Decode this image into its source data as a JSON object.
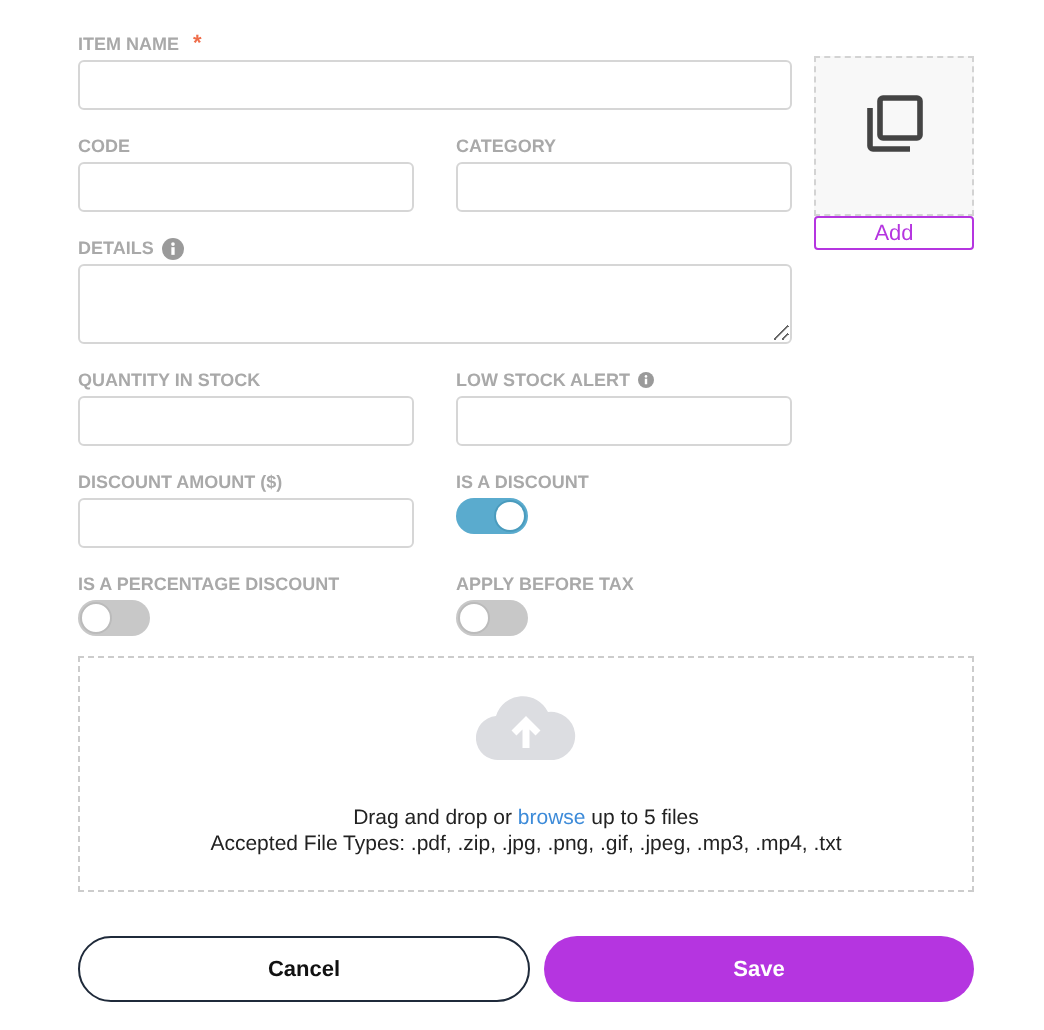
{
  "form": {
    "fields": [
      {
        "kind": "wide_text",
        "label": "ITEM NAME",
        "required": true
      },
      {
        "kind": "text",
        "label": "CODE"
      },
      {
        "kind": "text",
        "label": "CATEGORY"
      },
      {
        "kind": "textarea",
        "label": "DETAILS",
        "info": true
      },
      {
        "kind": "text",
        "label": "QUANTITY IN STOCK"
      },
      {
        "kind": "text",
        "label": "LOW STOCK ALERT",
        "info": true
      },
      {
        "kind": "text",
        "label": "DISCOUNT AMOUNT ($)"
      },
      {
        "kind": "toggle",
        "label": "IS A DISCOUNT",
        "on": true
      },
      {
        "kind": "toggle",
        "label": "IS A PERCENTAGE DISCOUNT",
        "on": false
      },
      {
        "kind": "toggle",
        "label": "APPLY BEFORE TAX",
        "on": false
      }
    ],
    "required_mark": "*",
    "image": {
      "button": "Add"
    },
    "upload": {
      "before": "Drag and drop or ",
      "link": "browse",
      "after": " up to 5 files",
      "accepted": "Accepted File Types: .pdf, .zip, .jpg, .png, .gif, .jpeg, .mp3, .mp4, .txt"
    },
    "buttons": [
      {
        "kind": "secondary",
        "label": "Cancel"
      },
      {
        "kind": "primary",
        "label": "Save"
      }
    ]
  }
}
